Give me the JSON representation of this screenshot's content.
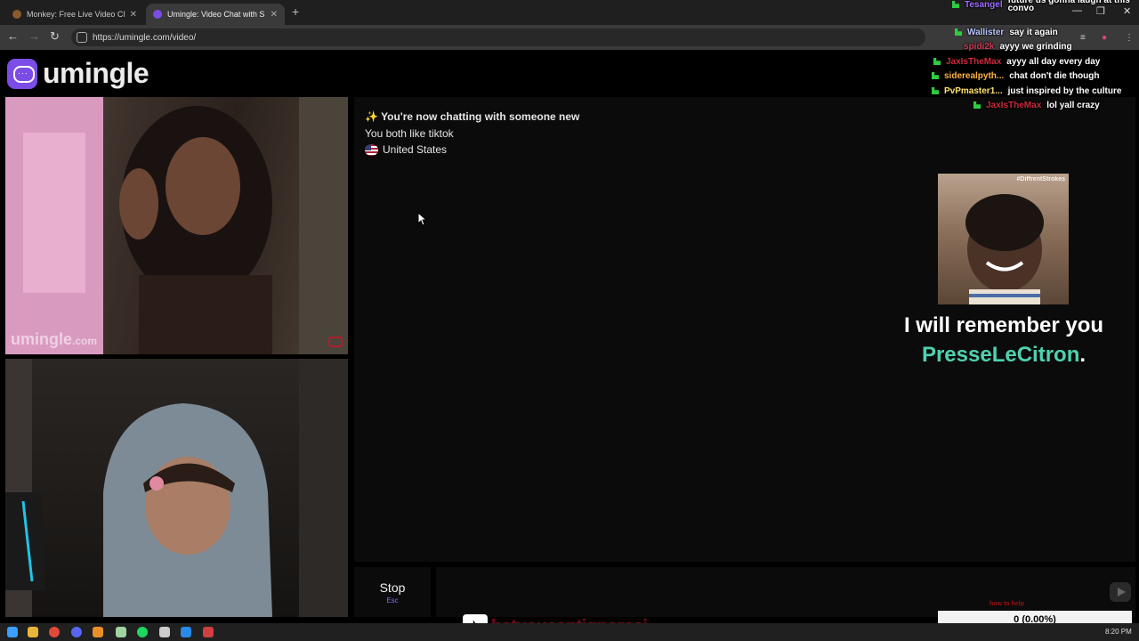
{
  "browser": {
    "tabs": [
      {
        "title": "Monkey: Free Live Video Ch",
        "active": false
      },
      {
        "title": "Umingle: Video Chat with S",
        "active": true
      }
    ],
    "url": "https://umingle.com/video/"
  },
  "site": {
    "name": "umingle",
    "watermark": "umingle",
    "watermark_suffix": ".com",
    "accent_color": "#7c4ce6"
  },
  "chat": {
    "system_title": "You're now chatting with someone new",
    "system_icon": "sparkles-icon",
    "interest": "You both like tiktok",
    "country": "United States",
    "country_flag": "us-flag-icon"
  },
  "controls": {
    "stop_label": "Stop",
    "stop_key": "Esc",
    "message_placeholder": "",
    "send_icon": "send-icon"
  },
  "stream_chat": [
    {
      "user": "Tesangel",
      "color": "#9b6cff",
      "text": "future us gonna laugh at this convo"
    },
    {
      "user": "Wallister",
      "color": "#b9c8ff",
      "text": "say it again"
    },
    {
      "user": "spidi2k",
      "color": "#cc3a56",
      "text": "ayyy we grinding"
    },
    {
      "user": "JaxIsTheMax",
      "color": "#cc2a3a",
      "text": "ayyy all day every day"
    },
    {
      "user": "siderealpyth...",
      "color": "#ffb347",
      "text": "chat don't die though"
    },
    {
      "user": "PvPmaster1...",
      "color": "#ffe36e",
      "text": "just inspired by the culture"
    },
    {
      "user": "JaxIsTheMax",
      "color": "#cc2a3a",
      "text": "lol yall crazy"
    }
  ],
  "overlay": {
    "gif_tag": "#DiffrentStrokes",
    "remember_line": "I will remember you",
    "remember_name": "PresseLeCitron",
    "remember_punct": ".",
    "goal_value": "0 (0.00%)",
    "goal_title": "how to help",
    "tiktok_handle": "betyoucantignoreej"
  },
  "taskbar": {
    "clock": "8:20 PM"
  }
}
